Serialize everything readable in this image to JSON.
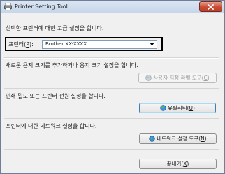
{
  "window": {
    "title": "Printer Setting Tool"
  },
  "intro": {
    "text": "선택한 프린터에 대한 고급 설정을 합니다."
  },
  "printer": {
    "label_prefix": "프린터(",
    "label_accel": "P",
    "label_suffix": "):",
    "selected": "Brother XX-XXXX"
  },
  "paper": {
    "text": "새로운 용지 크기를 추가하거나 용지 크기 설정을 합니다.",
    "button_prefix": "사용자 지정 라벨 도구(",
    "button_accel": "C",
    "button_suffix": ")",
    "enabled": false
  },
  "utility": {
    "text": "인쇄 밀도 또는 프린터 전원 설정을 합니다.",
    "button_prefix": "유틸리티(",
    "button_accel": "U",
    "button_suffix": ")"
  },
  "network": {
    "text": "프린터에 대한 네트워크 설정을 합니다.",
    "button_prefix": "네트워크 설정 도구(",
    "button_accel": "N",
    "button_suffix": ")"
  },
  "exit": {
    "button_prefix": "끝내기(",
    "button_accel": "X",
    "button_suffix": ")"
  },
  "colors": {
    "close_button": "#c74a34",
    "highlight_frame": "#000000",
    "titlebar": "#c7d6ea"
  },
  "icons": {
    "app": "printer-icon",
    "close": "close-icon",
    "combo": "chevron-down-icon",
    "paper_button": "globe-icon",
    "utility_button": "globe-icon",
    "network_button": "globe-icon"
  }
}
